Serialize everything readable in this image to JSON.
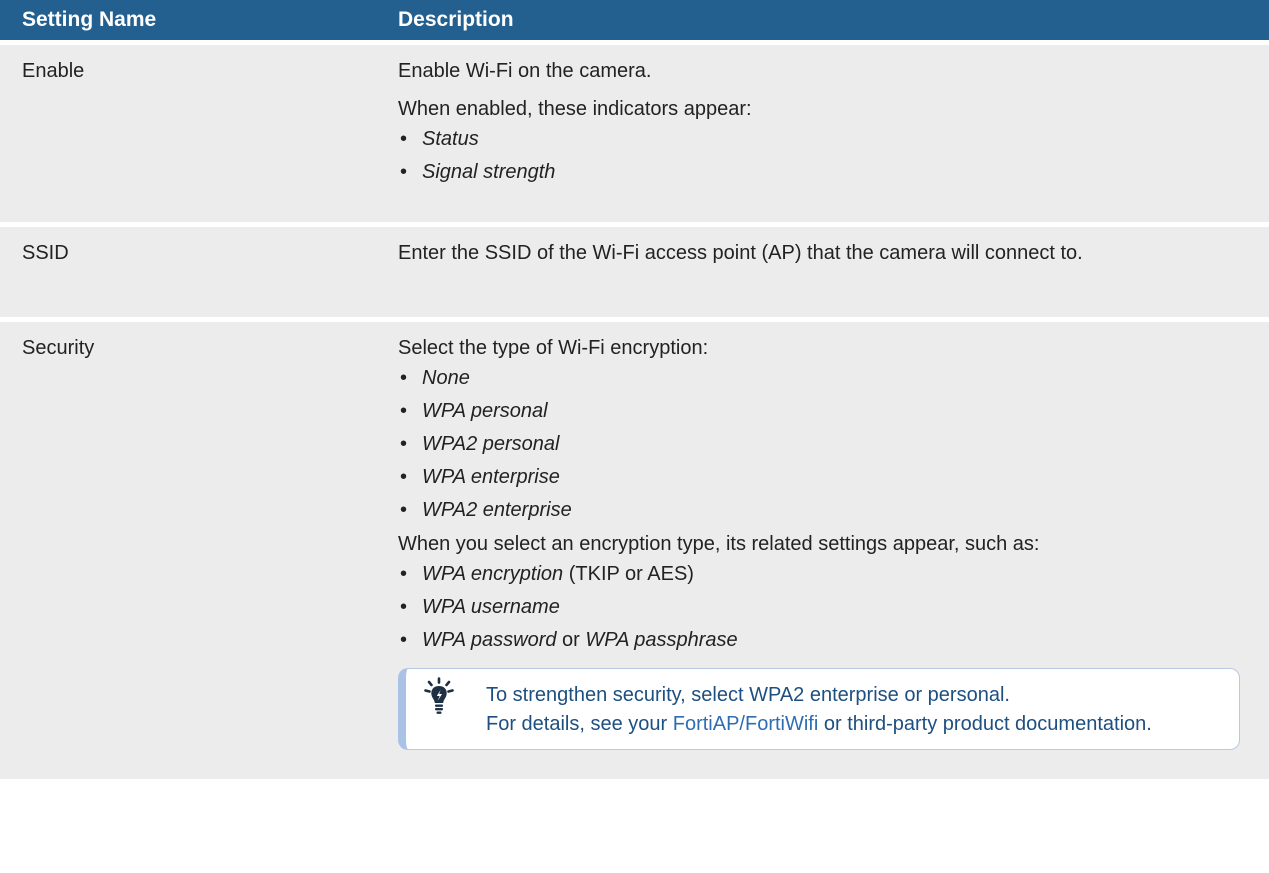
{
  "table": {
    "headers": [
      "Setting Name",
      "Description"
    ],
    "rows": {
      "enable": {
        "name": "Enable",
        "p1": "Enable Wi-Fi on the camera.",
        "p2": "When enabled, these indicators appear:",
        "bullets": [
          "Status",
          "Signal strength"
        ]
      },
      "ssid": {
        "name": "SSID",
        "p1": "Enter the SSID of the Wi-Fi access point (AP) that the camera will connect to."
      },
      "security": {
        "name": "Security",
        "p1": "Select the type of Wi-Fi encryption:",
        "types": [
          "None",
          "WPA personal",
          "WPA2 personal",
          "WPA enterprise",
          "WPA2 enterprise"
        ],
        "p2": "When you select an encryption type, its related settings appear, such as:",
        "related": {
          "encryption": "WPA encryption",
          "encryption_suffix": " (TKIP or AES)",
          "username": "WPA username",
          "password": "WPA password",
          "or": " or ",
          "passphrase": "WPA passphrase"
        },
        "tip": {
          "line1": "To strengthen security, select WPA2 enterprise or personal.",
          "prefix": "For details, see your ",
          "link": "FortiAP/FortiWifi",
          "suffix": " or third-party product documentation."
        }
      }
    }
  },
  "bullet_char": "•",
  "colors": {
    "header_bg": "#23608f",
    "row_bg": "#ececec",
    "tip_border": "#a9c2e6",
    "tip_text": "#1d4f80",
    "tip_link": "#2f6db3"
  },
  "icons": {
    "tip": "lightbulb-icon"
  }
}
